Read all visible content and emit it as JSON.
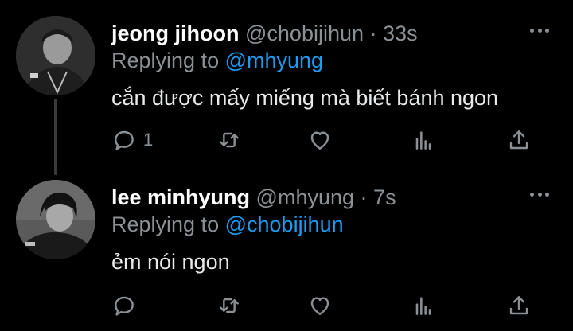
{
  "tweets": [
    {
      "display_name": "jeong jihoon",
      "handle": "@chobijihun",
      "separator": "·",
      "time": "33s",
      "replying_prefix": "Replying to",
      "replying_to": "@mhyung",
      "text": "cắn được mấy miếng mà biết bánh ngon",
      "reply_count": "1"
    },
    {
      "display_name": "lee minhyung",
      "handle": "@mhyung",
      "separator": "·",
      "time": "7s",
      "replying_prefix": "Replying to",
      "replying_to": "@chobijihun",
      "text": "ẻm nói ngon",
      "reply_count": ""
    }
  ],
  "colors": {
    "background": "#000000",
    "muted": "#8b9094",
    "link": "#1d9bf0",
    "text": "#e7e9ea"
  },
  "icons": [
    "more-icon",
    "reply-icon",
    "retweet-icon",
    "like-icon",
    "stats-icon",
    "share-icon"
  ]
}
